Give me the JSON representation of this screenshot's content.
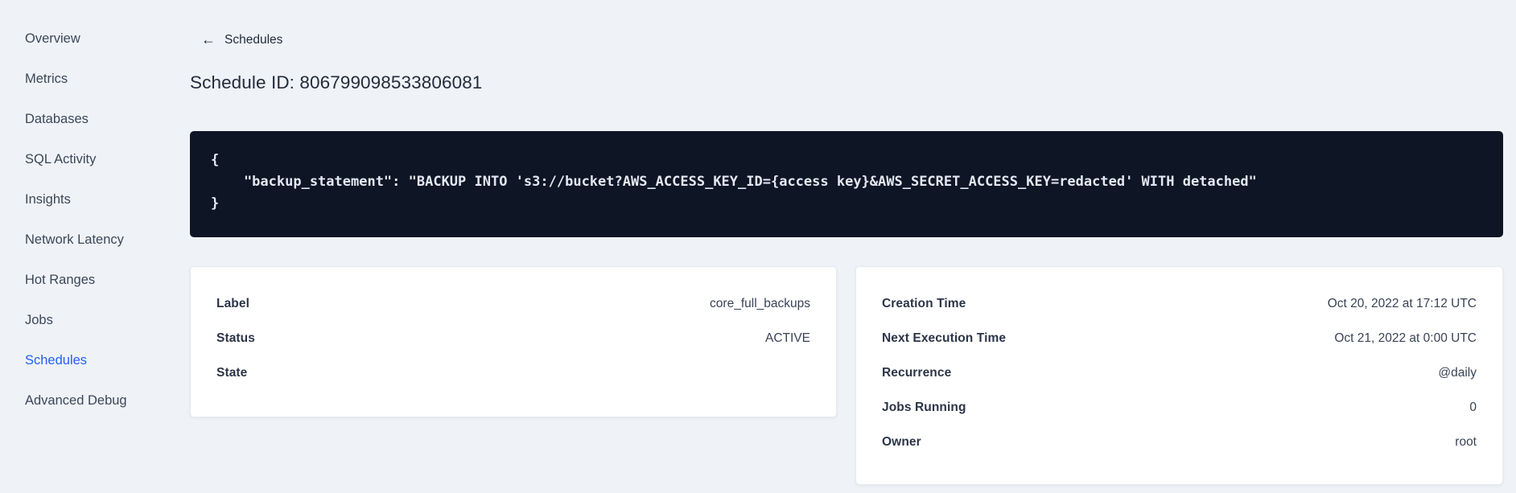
{
  "colors": {
    "page_background": "#eff3f7",
    "accent_active_link": "#2161f0",
    "code_block_background": "#0e1524",
    "code_text": "#e3e9f3",
    "card_background": "#ffffff"
  },
  "sidebar": {
    "items": [
      {
        "label": "Overview",
        "active": false
      },
      {
        "label": "Metrics",
        "active": false
      },
      {
        "label": "Databases",
        "active": false
      },
      {
        "label": "SQL Activity",
        "active": false
      },
      {
        "label": "Insights",
        "active": false
      },
      {
        "label": "Network Latency",
        "active": false
      },
      {
        "label": "Hot Ranges",
        "active": false
      },
      {
        "label": "Jobs",
        "active": false
      },
      {
        "label": "Schedules",
        "active": true
      },
      {
        "label": "Advanced Debug",
        "active": false
      }
    ]
  },
  "header": {
    "back_arrow": "←",
    "back_label": "Schedules",
    "title": "Schedule ID: 806799098533806081"
  },
  "schedule": {
    "code": "{\n    \"backup_statement\": \"BACKUP INTO 's3://bucket?AWS_ACCESS_KEY_ID={access key}&AWS_SECRET_ACCESS_KEY=redacted' WITH detached\"\n}"
  },
  "details_left": {
    "rows": [
      {
        "label": "Label",
        "value": "core_full_backups"
      },
      {
        "label": "Status",
        "value": "ACTIVE"
      },
      {
        "label": "State",
        "value": ""
      }
    ]
  },
  "details_right": {
    "rows": [
      {
        "label": "Creation Time",
        "value": "Oct 20, 2022 at 17:12 UTC"
      },
      {
        "label": "Next Execution Time",
        "value": "Oct 21, 2022 at 0:00 UTC"
      },
      {
        "label": "Recurrence",
        "value": "@daily"
      },
      {
        "label": "Jobs Running",
        "value": "0"
      },
      {
        "label": "Owner",
        "value": "root"
      }
    ]
  }
}
